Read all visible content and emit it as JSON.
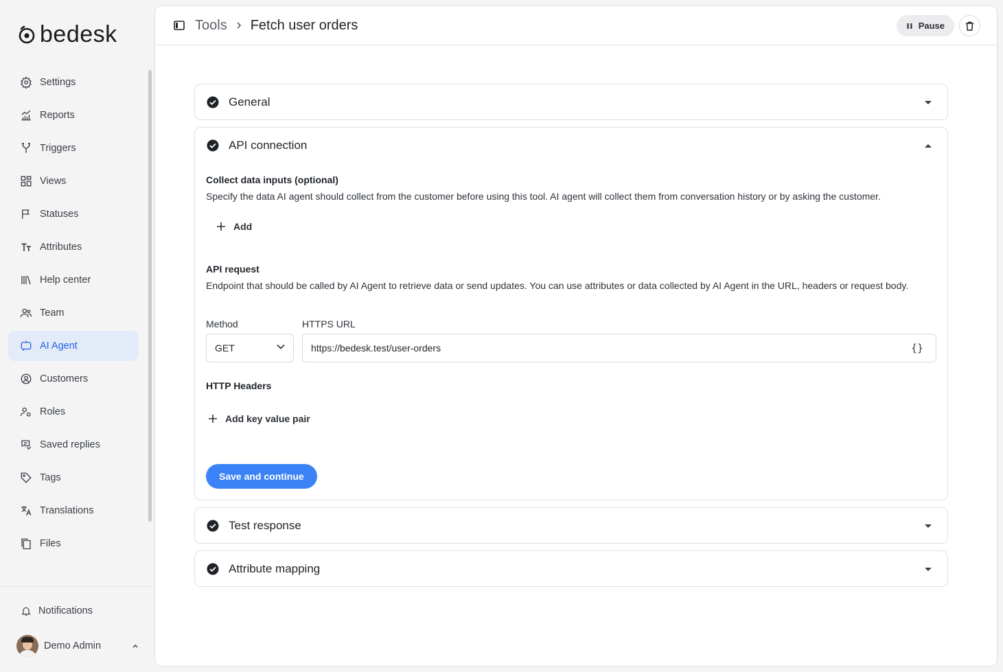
{
  "brand": {
    "name": "bedesk"
  },
  "sidebar": {
    "items": [
      {
        "label": "Settings",
        "icon": "gear-icon"
      },
      {
        "label": "Reports",
        "icon": "chart-icon"
      },
      {
        "label": "Triggers",
        "icon": "branch-icon"
      },
      {
        "label": "Views",
        "icon": "grid-icon"
      },
      {
        "label": "Statuses",
        "icon": "flag-icon"
      },
      {
        "label": "Attributes",
        "icon": "text-icon"
      },
      {
        "label": "Help center",
        "icon": "books-icon"
      },
      {
        "label": "Team",
        "icon": "people-icon"
      },
      {
        "label": "AI Agent",
        "icon": "chat-bot-icon",
        "active": true
      },
      {
        "label": "Customers",
        "icon": "user-circle-icon"
      },
      {
        "label": "Roles",
        "icon": "user-gear-icon"
      },
      {
        "label": "Saved replies",
        "icon": "saved-replies-icon"
      },
      {
        "label": "Tags",
        "icon": "tag-icon"
      },
      {
        "label": "Translations",
        "icon": "translate-icon"
      },
      {
        "label": "Files",
        "icon": "files-icon"
      }
    ],
    "notifications": "Notifications",
    "user_name": "Demo Admin"
  },
  "header": {
    "parent": "Tools",
    "current": "Fetch user orders",
    "pause_label": "Pause"
  },
  "panels": {
    "general": "General",
    "api": "API connection",
    "test": "Test response",
    "mapping": "Attribute mapping"
  },
  "api": {
    "collect_title": "Collect data inputs (optional)",
    "collect_desc": "Specify the data AI agent should collect from the customer before using this tool. AI agent will collect them from conversation history or by asking the customer.",
    "add_label": "Add",
    "request_title": "API request",
    "request_desc": "Endpoint that should be called by AI Agent to retrieve data or send updates. You can use attributes or data collected by AI Agent in the URL, headers or request body.",
    "method_label": "Method",
    "method_value": "GET",
    "url_label": "HTTPS URL",
    "url_value": "https://bedesk.test/user-orders",
    "headers_title": "HTTP Headers",
    "add_pair_label": "Add key value pair",
    "save_label": "Save and continue"
  },
  "colors": {
    "accent": "#3b82f6",
    "active_bg": "#e3ebf8",
    "active_text": "#2563eb"
  }
}
